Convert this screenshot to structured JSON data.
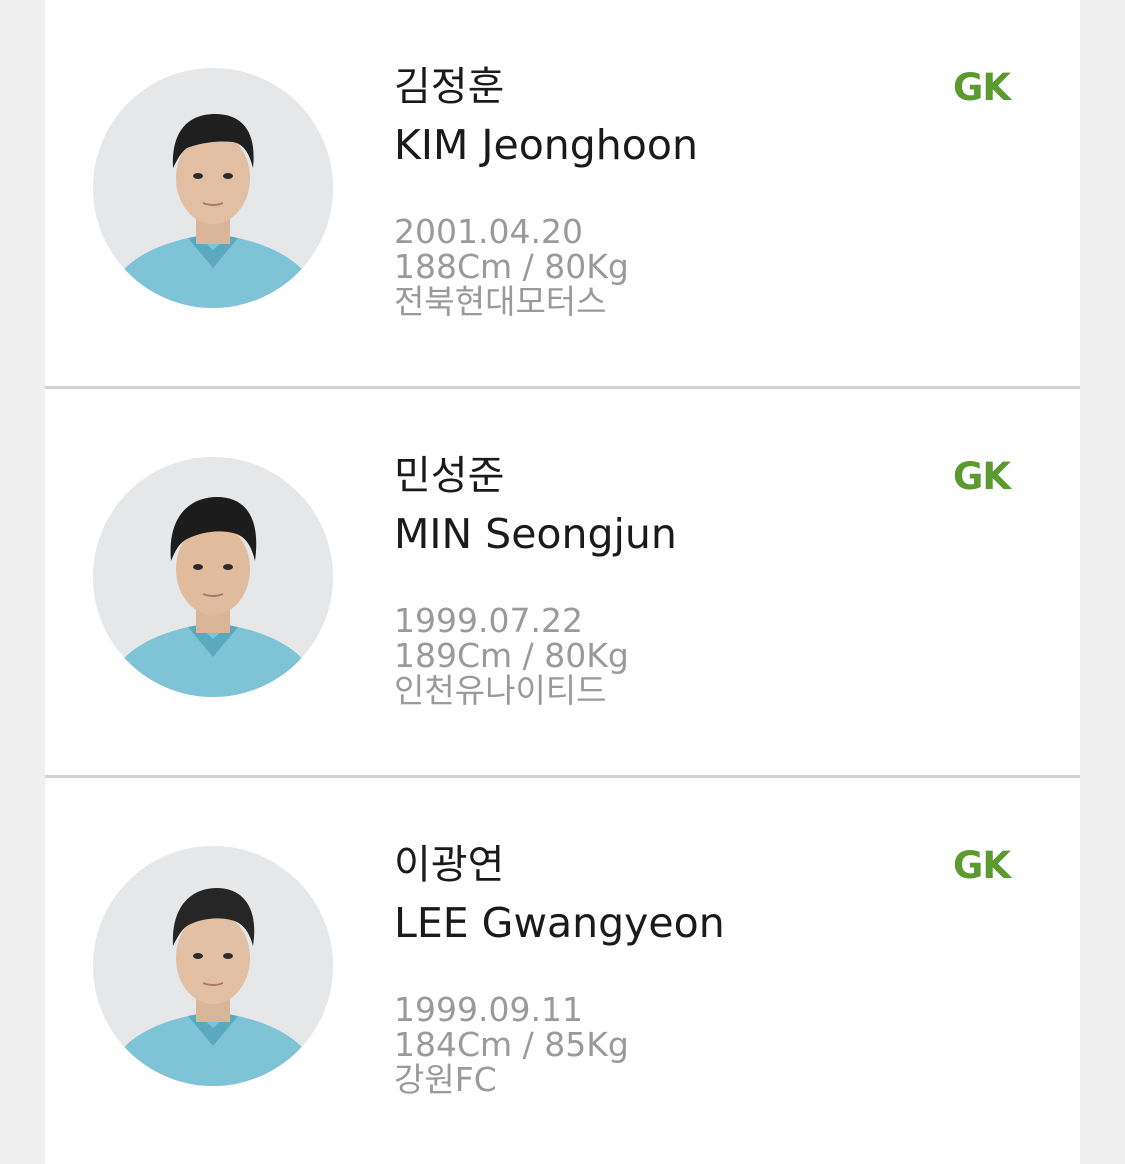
{
  "accent_color": "#5a9a2e",
  "players": [
    {
      "name_ko": "김정훈",
      "name_en": "KIM Jeonghoon",
      "birth": "2001.04.20",
      "body": "188Cm / 80Kg",
      "club": "전북현대모터스",
      "position": "GK"
    },
    {
      "name_ko": "민성준",
      "name_en": "MIN Seongjun",
      "birth": "1999.07.22",
      "body": "189Cm / 80Kg",
      "club": "인천유나이티드",
      "position": "GK"
    },
    {
      "name_ko": "이광연",
      "name_en": "LEE Gwangyeon",
      "birth": "1999.09.11",
      "body": "184Cm / 85Kg",
      "club": "강원FC",
      "position": "GK"
    }
  ]
}
